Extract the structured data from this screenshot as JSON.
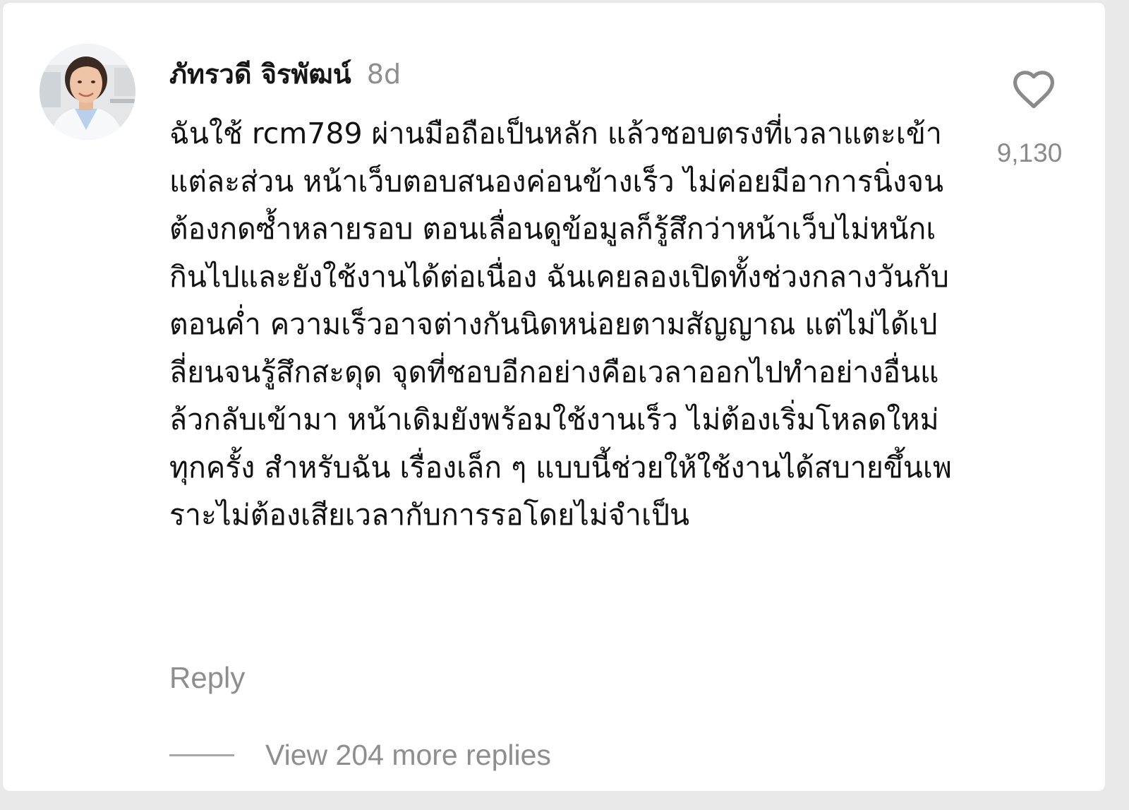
{
  "comment": {
    "author": "ภัทรวดี จิรพัฒน์",
    "time_ago": "8d",
    "text": "ฉันใช้ rcm789 ผ่านมือถือเป็นหลัก แล้วชอบตรงที่เวลาแตะเข้าแต่ละส่วน หน้าเว็บตอบสนองค่อนข้างเร็ว ไม่ค่อยมีอาการนิ่งจนต้องกดซ้ำหลายรอบ ตอนเลื่อนดูข้อมูลก็รู้สึกว่าหน้าเว็บไม่หนักเกินไปและยังใช้งานได้ต่อเนื่อง ฉันเคยลองเปิดทั้งช่วงกลางวันกับตอนค่ำ ความเร็วอาจต่างกันนิดหน่อยตามสัญญาณ แต่ไม่ได้เปลี่ยนจนรู้สึกสะดุด จุดที่ชอบอีกอย่างคือเวลาออกไปทำอย่างอื่นแล้วกลับเข้ามา หน้าเดิมยังพร้อมใช้งานเร็ว ไม่ต้องเริ่มโหลดใหม่ทุกครั้ง สำหรับฉัน เรื่องเล็ก ๆ แบบนี้ช่วยให้ใช้งานได้สบายขึ้นเพราะไม่ต้องเสียเวลากับการรอโดยไม่จำเป็น",
    "reply_label": "Reply",
    "view_replies_label": "View 204 more replies",
    "like_count": "9,130",
    "like_icon": "heart-outline-icon"
  },
  "colors": {
    "background": "#ffffff",
    "text_primary": "#141414",
    "text_secondary": "#8e8e8e"
  }
}
